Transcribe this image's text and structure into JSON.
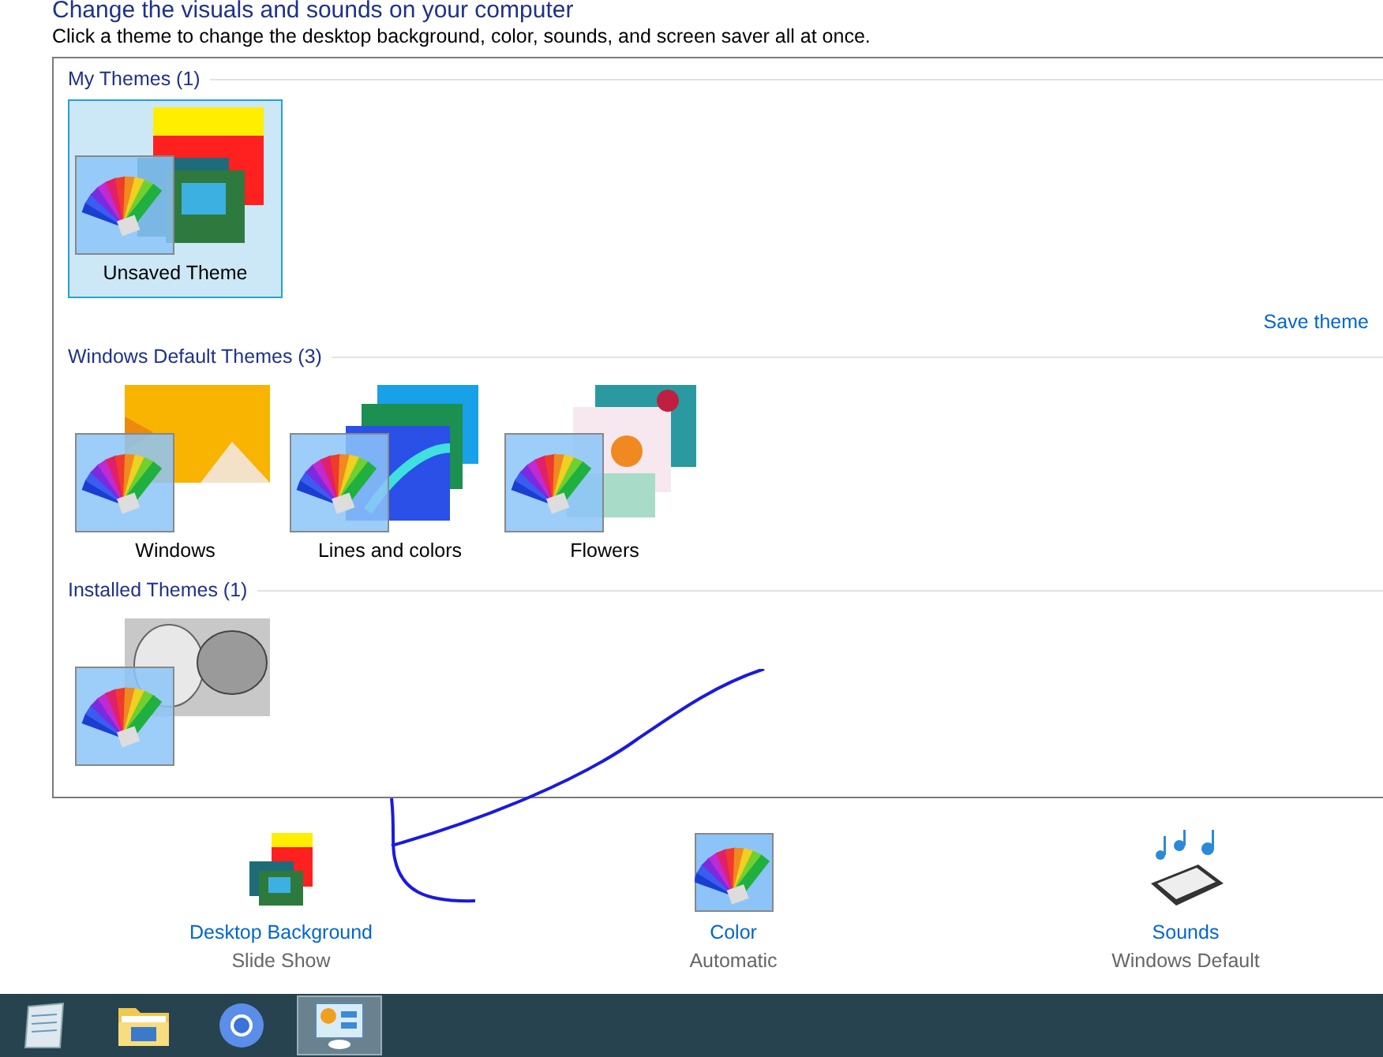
{
  "header": {
    "title": "Change the visuals and sounds on your computer",
    "description": "Click a theme to change the desktop background, color, sounds, and screen saver all at once."
  },
  "theme_groups": [
    {
      "title": "My Themes (1)",
      "themes": [
        {
          "name": "Unsaved Theme",
          "kind": "custom",
          "selected": true
        }
      ],
      "link": "Save theme"
    },
    {
      "title": "Windows Default Themes (3)",
      "themes": [
        {
          "name": "Windows",
          "kind": "windows",
          "selected": false
        },
        {
          "name": "Lines and colors",
          "kind": "lines",
          "selected": false
        },
        {
          "name": "Flowers",
          "kind": "flowers",
          "selected": false
        }
      ]
    },
    {
      "title": "Installed Themes (1)",
      "themes": [
        {
          "kind": "stones",
          "selected": false
        }
      ]
    }
  ],
  "settings": [
    {
      "kind": "background",
      "label": "Desktop Background",
      "value": "Slide Show"
    },
    {
      "kind": "color",
      "label": "Color",
      "value": "Automatic"
    },
    {
      "kind": "sounds",
      "label": "Sounds",
      "value": "Windows Default"
    }
  ],
  "taskbar": [
    {
      "kind": "notepad",
      "selected": false
    },
    {
      "kind": "folder",
      "selected": false
    },
    {
      "kind": "browser",
      "selected": false
    },
    {
      "kind": "control-panel",
      "selected": true
    }
  ]
}
